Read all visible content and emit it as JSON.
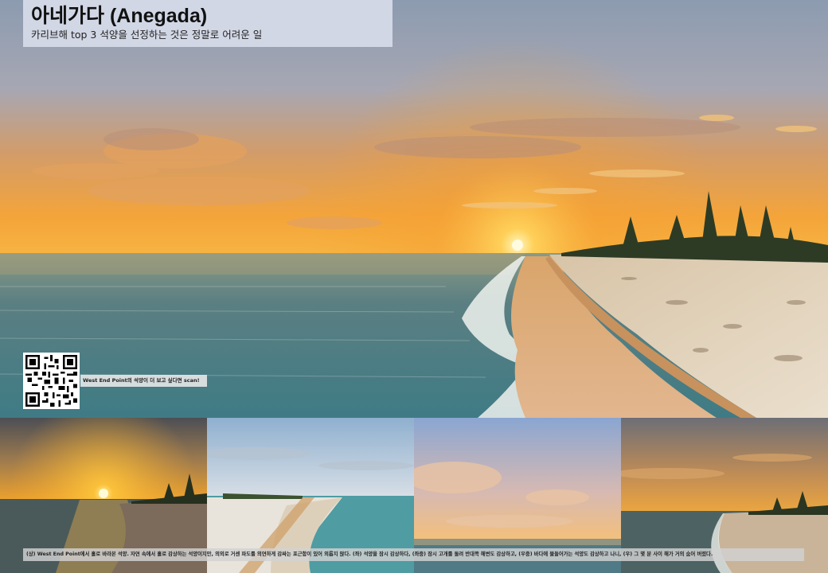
{
  "header": {
    "title": "아네가다 (Anegada)",
    "subtitle": "카리브해 top 3 석양을 선정하는 것은 정말로 어려운 일"
  },
  "qr": {
    "caption": "West End Point의 석양이 더 보고 싶다면 scan!"
  },
  "photos": {
    "hero": "sunset-beach-photo",
    "thumbnails": [
      "sunset-over-sea",
      "white-sand-beach",
      "evening-sky",
      "sunset-shoreline"
    ]
  },
  "caption": {
    "text": "(상) West End Point에서 홀로 바라본 석양. 자연 속에서 홀로 감상하는 석양이지만, 의외로 거센 파도를 의연하게 감싸는 포근함이 있어 외롭지 않다. (좌) 석양을 잠시 감상하다, (좌중) 잠시 고개를 돌려 반대쪽 해변도 감상하고, (우중) 바다에 물들어가는 석양도 감상하고 나니, (우) 그 몇 분 사이 해가 거의 숨어 버렸다."
  }
}
